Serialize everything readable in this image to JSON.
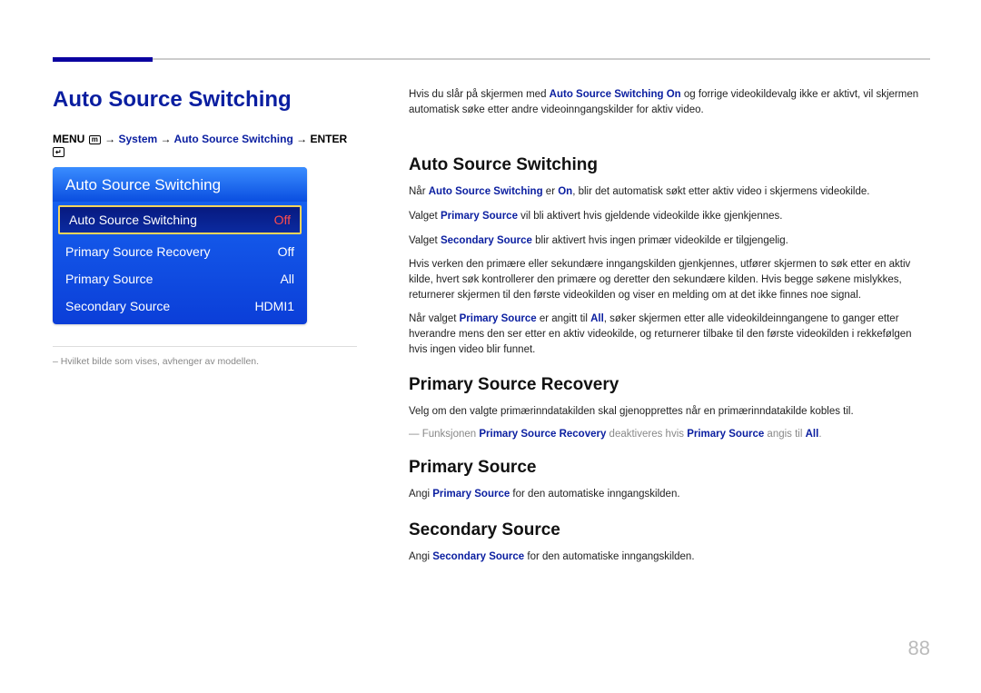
{
  "page": {
    "title": "Auto Source Switching",
    "number": "88"
  },
  "breadcrumb": {
    "menu": "MENU",
    "arrow": "→",
    "system": "System",
    "item": "Auto Source Switching",
    "enter": "ENTER"
  },
  "menu": {
    "header": "Auto Source Switching",
    "items": [
      {
        "label": "Auto Source Switching",
        "value": "Off",
        "selected": true
      },
      {
        "label": "Primary Source Recovery",
        "value": "Off",
        "selected": false
      },
      {
        "label": "Primary Source",
        "value": "All",
        "selected": false
      },
      {
        "label": "Secondary Source",
        "value": "HDMI1",
        "selected": false
      }
    ]
  },
  "footnote": "Hvilket bilde som vises, avhenger av modellen.",
  "intro": {
    "p1a": "Hvis du slår på skjermen med ",
    "p1em": "Auto Source Switching On",
    "p1b": " og forrige videokildevalg ikke er aktivt, vil skjermen automatisk søke etter andre videoinngangskilder for aktiv video."
  },
  "sec1": {
    "heading": "Auto Source Switching",
    "p1a": "Når ",
    "p1em1": "Auto Source Switching",
    "p1b": " er ",
    "p1em2": "On",
    "p1c": ", blir det automatisk søkt etter aktiv video i skjermens videokilde.",
    "p2a": "Valget ",
    "p2em": "Primary Source",
    "p2b": " vil bli aktivert hvis gjeldende videokilde ikke gjenkjennes.",
    "p3a": "Valget ",
    "p3em": "Secondary Source",
    "p3b": " blir aktivert hvis ingen primær videokilde er tilgjengelig.",
    "p4": "Hvis verken den primære eller sekundære inngangskilden gjenkjennes, utfører skjermen to søk etter en aktiv kilde, hvert søk kontrollerer den primære og deretter den sekundære kilden. Hvis begge søkene mislykkes, returnerer skjermen til den første videokilden og viser en melding om at det ikke finnes noe signal.",
    "p5a": "Når valget ",
    "p5em1": "Primary Source",
    "p5b": " er angitt til ",
    "p5em2": "All",
    "p5c": ", søker skjermen etter alle videokildeinngangene to ganger etter hverandre mens den ser etter en aktiv videokilde, og returnerer tilbake til den første videokilden i rekkefølgen hvis ingen video blir funnet."
  },
  "sec2": {
    "heading": "Primary Source Recovery",
    "p1": "Velg om den valgte primærinndatakilden skal gjenopprettes når en primærinndatakilde kobles til.",
    "note_a": "Funksjonen ",
    "note_em1": "Primary Source Recovery",
    "note_b": " deaktiveres hvis ",
    "note_em2": "Primary Source",
    "note_c": " angis til ",
    "note_em3": "All",
    "note_d": "."
  },
  "sec3": {
    "heading": "Primary Source",
    "p1a": "Angi ",
    "p1em": "Primary Source",
    "p1b": " for den automatiske inngangskilden."
  },
  "sec4": {
    "heading": "Secondary Source",
    "p1a": "Angi ",
    "p1em": "Secondary Source",
    "p1b": " for den automatiske inngangskilden."
  }
}
